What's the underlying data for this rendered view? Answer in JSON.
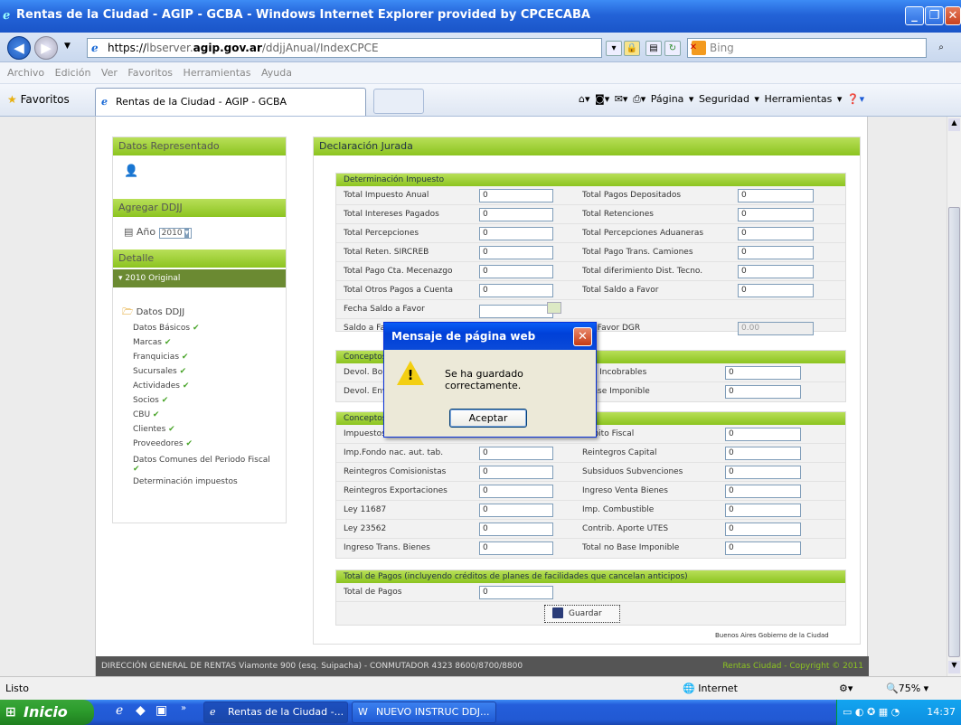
{
  "window": {
    "title": "Rentas de la Ciudad - AGIP - GCBA - Windows Internet Explorer provided by CPCECABA"
  },
  "address": {
    "scheme": "https://",
    "host_prefix": "lbserver.",
    "host_domain": "agip.gov.ar",
    "path": "/ddjjAnual/IndexCPCE",
    "search_placeholder": "Bing"
  },
  "menu": [
    "Archivo",
    "Edición",
    "Ver",
    "Favoritos",
    "Herramientas",
    "Ayuda"
  ],
  "favorites": {
    "label": "Favoritos",
    "tab_title": "Rentas de la Ciudad - AGIP - GCBA",
    "commands": "Página ▾   Seguridad ▾   Herramientas ▾"
  },
  "sidebar": {
    "represented_title": "Datos Representado",
    "add_title": "Agregar DDJJ",
    "year_label": "Año",
    "year_value": "2010",
    "detail_title": "Detalle",
    "original_label": "▾ 2010 Original",
    "ddjj_folder": "Datos DDJJ",
    "items": [
      "Datos Básicos",
      "Marcas",
      "Franquicias",
      "Sucursales",
      "Actividades",
      "Socios",
      "CBU",
      "Clientes",
      "Proveedores",
      "Datos Comunes del Periodo Fiscal",
      "Determinación impuestos"
    ]
  },
  "main": {
    "title": "Declaración Jurada",
    "section1": "Determinación Impuesto",
    "rows1": [
      {
        "l": "Total Impuesto Anual",
        "v": "0",
        "r": "Total Pagos Depositados",
        "rv": "0"
      },
      {
        "l": "Total Intereses Pagados",
        "v": "0",
        "r": "Total Retenciones",
        "rv": "0"
      },
      {
        "l": "Total Percepciones",
        "v": "0",
        "r": "Total Percepciones Aduaneras",
        "rv": "0"
      },
      {
        "l": "Total Reten. SIRCREB",
        "v": "0",
        "r": "Total Pago Trans. Camiones",
        "rv": "0"
      },
      {
        "l": "Total Pago Cta. Mecenazgo",
        "v": "0",
        "r": "Total diferimiento Dist. Tecno.",
        "rv": "0"
      },
      {
        "l": "Total Otros Pagos a Cuenta",
        "v": "0",
        "r": "Total Saldo a Favor",
        "rv": "0"
      }
    ],
    "fecha_label": "Fecha Saldo a Favor",
    "saldo_label": "Saldo a Fa",
    "saldo_right": "o a Favor DGR",
    "saldo_right_value": "0.00",
    "section2": "Conceptos",
    "rows2": [
      {
        "l": "Devol. Bon",
        "r": "itos Incobrables",
        "rv": "0"
      },
      {
        "l": "Devol. Env",
        "r": "l Base Imponible",
        "rv": "0"
      }
    ],
    "section3": "Conceptos",
    "rows3": [
      {
        "l": "Impuestos",
        "v": "",
        "r": "Débito Fiscal",
        "rv": "0"
      },
      {
        "l": "Imp.Fondo nac. aut. tab.",
        "v": "0",
        "r": "Reintegros Capital",
        "rv": "0"
      },
      {
        "l": "Reintegros Comisionistas",
        "v": "0",
        "r": "Subsiduos Subvenciones",
        "rv": "0"
      },
      {
        "l": "Reintegros Exportaciones",
        "v": "0",
        "r": "Ingreso Venta Bienes",
        "rv": "0"
      },
      {
        "l": "Ley 11687",
        "v": "0",
        "r": "Imp. Combustible",
        "rv": "0"
      },
      {
        "l": "Ley 23562",
        "v": "0",
        "r": "Contrib. Aporte UTES",
        "rv": "0"
      },
      {
        "l": "Ingreso Trans. Bienes",
        "v": "0",
        "r": "Total no Base Imponible",
        "rv": "0"
      }
    ],
    "section4": "Total de Pagos (incluyendo créditos de planes de facilidades que cancelan anticipos)",
    "total_pagos_label": "Total de Pagos",
    "total_pagos_value": "0",
    "save_label": "Guardar",
    "credit": "Buenos Aires Gobierno de la Ciudad"
  },
  "footer": {
    "text": "DIRECCIÓN GENERAL DE RENTAS Viamonte 900 (esq. Suipacha) - CONMUTADOR 4323 8600/8700/8800",
    "copyright": "Rentas Ciudad - Copyright © 2011"
  },
  "dialog": {
    "title": "Mensaje de página web",
    "message": "Se ha guardado correctamente.",
    "ok_label": "Aceptar"
  },
  "status": {
    "text": "Listo",
    "zone": "Internet",
    "zoom": "75%"
  },
  "taskbar": {
    "start": "Inicio",
    "tasks": [
      "Rentas de la Ciudad -...",
      "NUEVO INSTRUC DDJ..."
    ],
    "clock": "14:37"
  }
}
